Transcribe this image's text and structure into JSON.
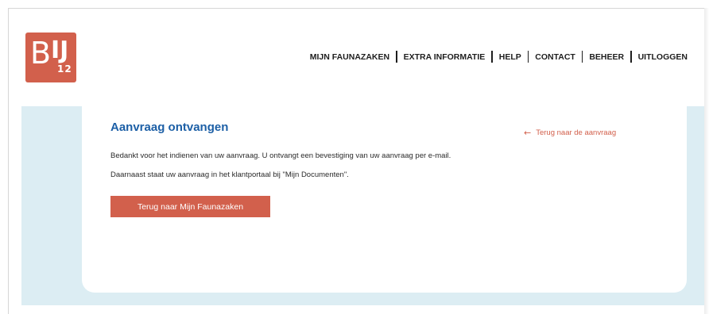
{
  "brand": {
    "logo_letters": "BIJ",
    "logo_number": "12",
    "logo_color": "#d2604c"
  },
  "nav": {
    "items": [
      {
        "label": "MIJN FAUNAZAKEN"
      },
      {
        "label": "EXTRA INFORMATIE"
      },
      {
        "label": "HELP"
      },
      {
        "label": "CONTACT"
      },
      {
        "label": "BEHEER"
      },
      {
        "label": "UITLOGGEN"
      }
    ]
  },
  "main": {
    "title": "Aanvraag ontvangen",
    "back_link": "Terug naar de aanvraag",
    "back_link_icon": "arrow-left-icon",
    "paragraph_1": "Bedankt voor het indienen van uw aanvraag. U ontvangt een bevestiging van uw aanvraag per e-mail.",
    "paragraph_2": "Daarnaast staat uw aanvraag in het klantportaal bij \"Mijn Documenten\".",
    "button_label": "Terug naar Mijn Faunazaken"
  },
  "colors": {
    "accent": "#d2604c",
    "title": "#1c5fa6",
    "band": "#dcedf3"
  }
}
